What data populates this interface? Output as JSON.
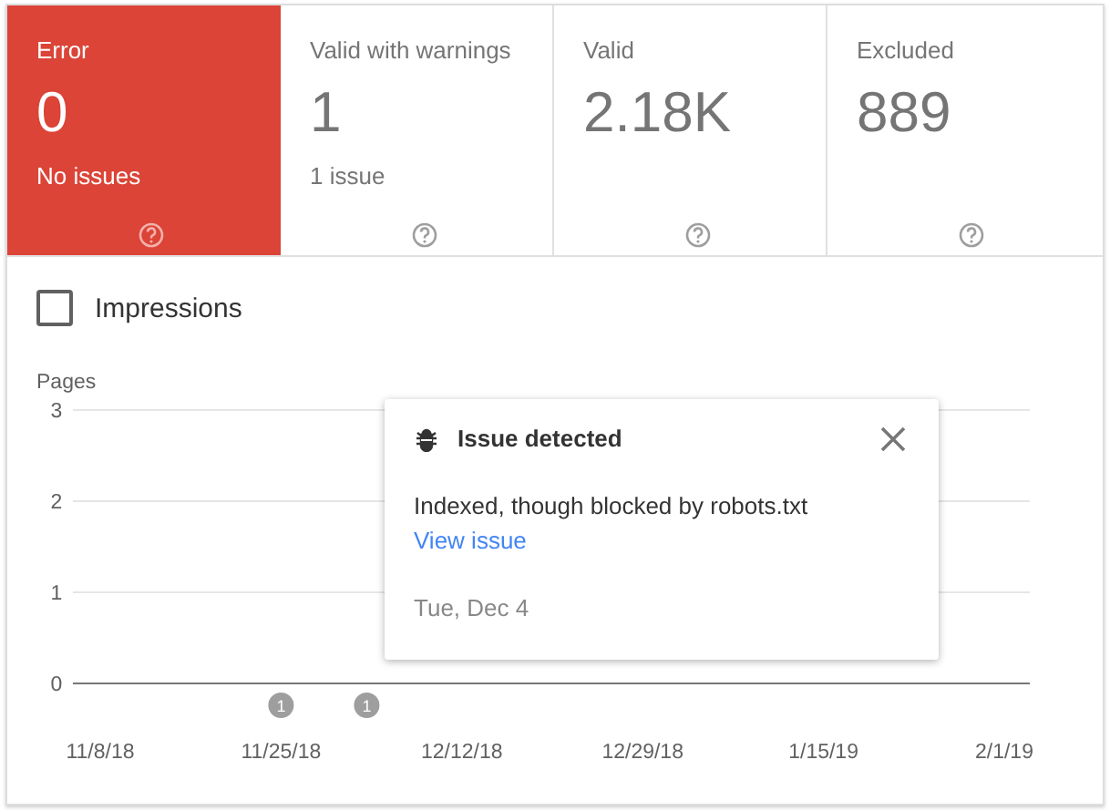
{
  "tiles": [
    {
      "label": "Error",
      "value": "0",
      "sub": "No issues",
      "selected": true
    },
    {
      "label": "Valid with warnings",
      "value": "1",
      "sub": "1 issue",
      "selected": false
    },
    {
      "label": "Valid",
      "value": "2.18K",
      "selected": false
    },
    {
      "label": "Excluded",
      "value": "889",
      "selected": false
    }
  ],
  "impressions": {
    "label": "Impressions",
    "checked": false
  },
  "chart_data": {
    "type": "line",
    "ylabel": "Pages",
    "ylim": [
      0,
      3
    ],
    "yticks": [
      0,
      1,
      2,
      3
    ],
    "categories": [
      "11/8/18",
      "11/25/18",
      "12/12/18",
      "12/29/18",
      "1/15/19",
      "2/1/19"
    ],
    "annotations": [
      "1",
      "1"
    ]
  },
  "popup": {
    "title": "Issue detected",
    "message": "Indexed, though blocked by robots.txt",
    "link": "View issue",
    "date": "Tue, Dec 4"
  }
}
